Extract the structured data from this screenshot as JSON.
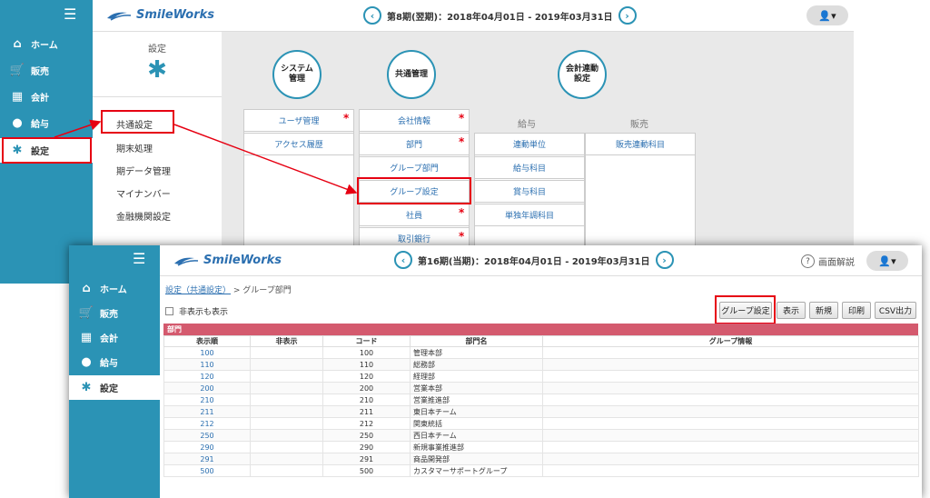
{
  "back": {
    "sidebar": {
      "menu_icon": "menu-icon",
      "items": [
        {
          "label": "ホーム",
          "icon": "home-icon",
          "glyph": "⌂"
        },
        {
          "label": "販売",
          "icon": "cart-icon",
          "glyph": "🛒"
        },
        {
          "label": "会計",
          "icon": "calculator-icon",
          "glyph": "▦"
        },
        {
          "label": "給与",
          "icon": "money-bag-icon",
          "glyph": "●"
        },
        {
          "label": "設定",
          "icon": "gear-icon",
          "glyph": "✱"
        }
      ]
    },
    "logo": "SmileWorks",
    "period": "第8期(翌期)：2018年04月01日 - 2019年03月31日",
    "prev": "‹",
    "next": "›",
    "user_glyph": "👤▾",
    "settings": {
      "title": "設定",
      "gear": "✱",
      "items": [
        "共通設定",
        "期末処理",
        "期データ管理",
        "マイナンバー",
        "金融機関設定"
      ]
    },
    "groups": {
      "system": "システム\n管理",
      "common": "共通管理",
      "accounting": "会計連動\n設定"
    },
    "system_cells": [
      "ユーザ管理",
      "アクセス履歴"
    ],
    "common_cells": [
      "会社情報",
      "部門",
      "グループ部門",
      "グループ設定",
      "社員",
      "取引銀行"
    ],
    "payroll_label": "給与",
    "sales_label": "販売",
    "payroll_cells": [
      "連動単位",
      "給与科目",
      "賞与科目",
      "単独年調科目"
    ],
    "sales_cells": [
      "販売連動科目"
    ],
    "star": "*"
  },
  "front": {
    "sidebar": {
      "items": [
        {
          "label": "ホーム",
          "icon": "home-icon",
          "glyph": "⌂"
        },
        {
          "label": "販売",
          "icon": "cart-icon",
          "glyph": "🛒"
        },
        {
          "label": "会計",
          "icon": "calculator-icon",
          "glyph": "▦"
        },
        {
          "label": "給与",
          "icon": "money-bag-icon",
          "glyph": "●"
        },
        {
          "label": "設定",
          "icon": "gear-icon",
          "glyph": "✱"
        }
      ]
    },
    "logo": "SmileWorks",
    "period": "第16期(当期)：2018年04月01日 - 2019年03月31日",
    "help": "画面解説",
    "help_glyph": "?",
    "user_glyph": "👤▾",
    "breadcrumb": {
      "link": "設定（共通設定）",
      "sep": " > ",
      "current": "グループ部門"
    },
    "show_hidden": "非表示も表示",
    "buttons": [
      "グループ設定",
      "表示",
      "新規",
      "印刷",
      "CSV出力"
    ],
    "section": "部門",
    "columns": [
      "表示順",
      "非表示",
      "コード",
      "部門名",
      "グループ情報"
    ],
    "rows": [
      [
        "100",
        "",
        "100",
        "管理本部",
        ""
      ],
      [
        "110",
        "",
        "110",
        "総務部",
        ""
      ],
      [
        "120",
        "",
        "120",
        "経理部",
        ""
      ],
      [
        "200",
        "",
        "200",
        "営業本部",
        ""
      ],
      [
        "210",
        "",
        "210",
        "営業推進部",
        ""
      ],
      [
        "211",
        "",
        "211",
        "東日本チーム",
        ""
      ],
      [
        "212",
        "",
        "212",
        "関東統括",
        ""
      ],
      [
        "250",
        "",
        "250",
        "西日本チーム",
        ""
      ],
      [
        "290",
        "",
        "290",
        "新規事業推進部",
        ""
      ],
      [
        "291",
        "",
        "291",
        "商品開発部",
        ""
      ],
      [
        "500",
        "",
        "500",
        "カスタマーサポートグループ",
        ""
      ]
    ]
  },
  "colors": {
    "accent": "#2b93b5",
    "highlight": "#e60012",
    "section": "#d45a6e"
  }
}
